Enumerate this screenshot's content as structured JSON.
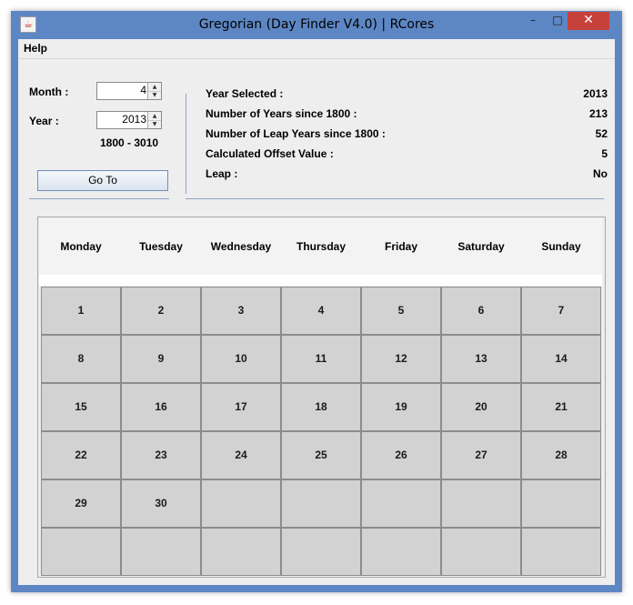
{
  "window": {
    "title": "Gregorian (Day Finder V4.0) | RCores",
    "minimize": "–",
    "maximize": "□",
    "close": "✕",
    "app_icon": "java-cup-icon"
  },
  "menu": {
    "help": "Help"
  },
  "controls": {
    "month_label": "Month :",
    "month_value": "4",
    "year_label": "Year :",
    "year_value": "2013",
    "range": "1800 - 3010",
    "goto_label": "Go To"
  },
  "info": [
    {
      "label": "Year Selected :",
      "value": "2013"
    },
    {
      "label": "Number of Years since 1800 :",
      "value": "213"
    },
    {
      "label": "Number of Leap Years since 1800 :",
      "value": "52"
    },
    {
      "label": "Calculated Offset Value :",
      "value": "5"
    },
    {
      "label": "Leap :",
      "value": "No"
    }
  ],
  "calendar": {
    "days": [
      "Monday",
      "Tuesday",
      "Wednesday",
      "Thursday",
      "Friday",
      "Saturday",
      "Sunday"
    ],
    "cells": [
      [
        "1",
        "2",
        "3",
        "4",
        "5",
        "6",
        "7"
      ],
      [
        "8",
        "9",
        "10",
        "11",
        "12",
        "13",
        "14"
      ],
      [
        "15",
        "16",
        "17",
        "18",
        "19",
        "20",
        "21"
      ],
      [
        "22",
        "23",
        "24",
        "25",
        "26",
        "27",
        "28"
      ],
      [
        "29",
        "30",
        "",
        "",
        "",
        "",
        ""
      ],
      [
        "",
        "",
        "",
        "",
        "",
        "",
        ""
      ]
    ]
  }
}
